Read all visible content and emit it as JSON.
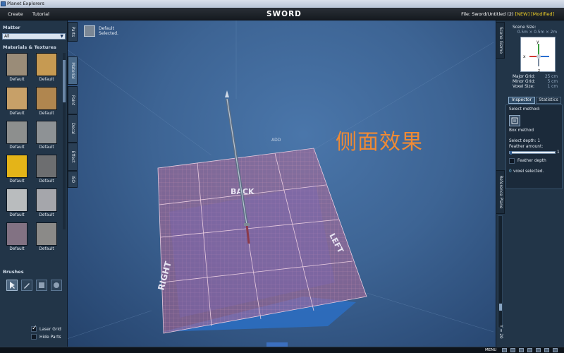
{
  "window": {
    "title": "Planet Explorers"
  },
  "menu": {
    "create": "Create",
    "tutorial": "Tutorial",
    "app_title": "SWORD",
    "file_prefix": "File: Sword/Untitled (2)",
    "new_tag": "[NEW]",
    "modified_tag": "[Modified]"
  },
  "left": {
    "matter_label": "Matter",
    "matter_value": "All",
    "materials_label": "Materials & Textures",
    "materials": [
      {
        "label": "Default",
        "color": "#9a8c78"
      },
      {
        "label": "Default",
        "color": "#c69a52"
      },
      {
        "label": "Default",
        "color": "#c7a068"
      },
      {
        "label": "Default",
        "color": "#b0864f"
      },
      {
        "label": "Default",
        "color": "#8d8f8e"
      },
      {
        "label": "Default",
        "color": "#8e9295"
      },
      {
        "label": "Default",
        "color": "#e4b418"
      },
      {
        "label": "Default",
        "color": "#6d6e70"
      },
      {
        "label": "Default",
        "color": "#b9bcbe"
      },
      {
        "label": "Default",
        "color": "#a5a6ab"
      },
      {
        "label": "Default",
        "color": "#827283"
      },
      {
        "label": "Default",
        "color": "#8b8a88"
      }
    ],
    "brushes_label": "Brushes",
    "laser_grid": "Laser Grid",
    "hide_parts": "Hide Parts"
  },
  "tabs": [
    "Parts",
    "Material",
    "Paint",
    "Decal",
    "Effect",
    "ISO"
  ],
  "viewport": {
    "selected_line1": "Default",
    "selected_line2": "Selected.",
    "add_label": "ADD",
    "grid_labels": {
      "back": "BACK",
      "left": "LEFT",
      "right": "RIGHT"
    },
    "caption": "侧面效果"
  },
  "right": {
    "scene_gizmo_tab": "Scene Gizmo",
    "scene_size_label": "Scene Size:",
    "scene_size_value": "0.5m × 0.5m × 2m",
    "major_grid_label": "Major Grid:",
    "major_grid_value": "25 cm",
    "minor_grid_label": "Minor Grid:",
    "minor_grid_value": "5 cm",
    "voxel_size_label": "Voxel Size:",
    "voxel_size_value": "1 cm",
    "axes": {
      "y": "y",
      "x": "x",
      "z": "z"
    },
    "inspector_tab": "Inspector",
    "statistics_tab": "Statistics",
    "select_method": "Select method:",
    "box_method": "Box method",
    "select_depth": "Select depth: 1",
    "feather_amount": "Feather amount:",
    "feather_value": "1",
    "feather_depth": "Feather depth",
    "voxel_selected_count": "0",
    "voxel_selected": "voxel selected.",
    "reference_plane_tab": "Reference Plane",
    "y_value": "Y = 20"
  },
  "status": {
    "menu": "MENU"
  },
  "colors": {
    "accent_yellow": "#f5d426",
    "caption_orange": "#f08a34",
    "viewport_blue": "#3d6494"
  }
}
